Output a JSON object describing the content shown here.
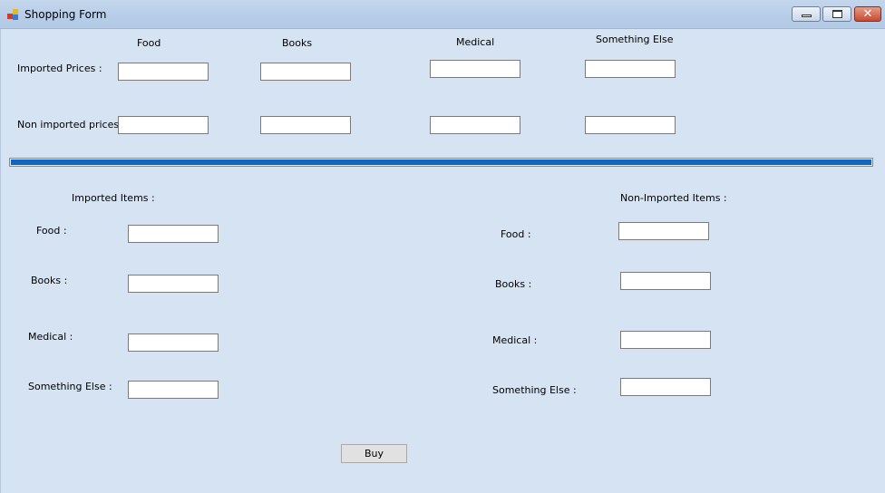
{
  "window": {
    "title": "Shopping Form",
    "controls": [
      "minimize",
      "maximize",
      "close"
    ]
  },
  "prices": {
    "columns": [
      "Food",
      "Books",
      "Medical",
      "Something Else"
    ],
    "imported_label": "Imported Prices :",
    "non_imported_label": "Non imported prices:",
    "imported_values": [
      "",
      "",
      "",
      ""
    ],
    "non_imported_values": [
      "",
      "",
      "",
      ""
    ]
  },
  "progress": {
    "value": 1.0,
    "color": "#1065c0"
  },
  "imported_items": {
    "heading": "Imported Items :",
    "food_label": "Food :",
    "books_label": "Books :",
    "medical_label": "Medical :",
    "something_else_label": "Something Else :",
    "values": [
      "",
      "",
      "",
      ""
    ]
  },
  "non_imported_items": {
    "heading": "Non-Imported Items :",
    "food_label": "Food :",
    "books_label": "Books :",
    "medical_label": "Medical :",
    "something_else_label": "Something Else :",
    "values": [
      "",
      "",
      "",
      ""
    ]
  },
  "buy_label": "Buy"
}
